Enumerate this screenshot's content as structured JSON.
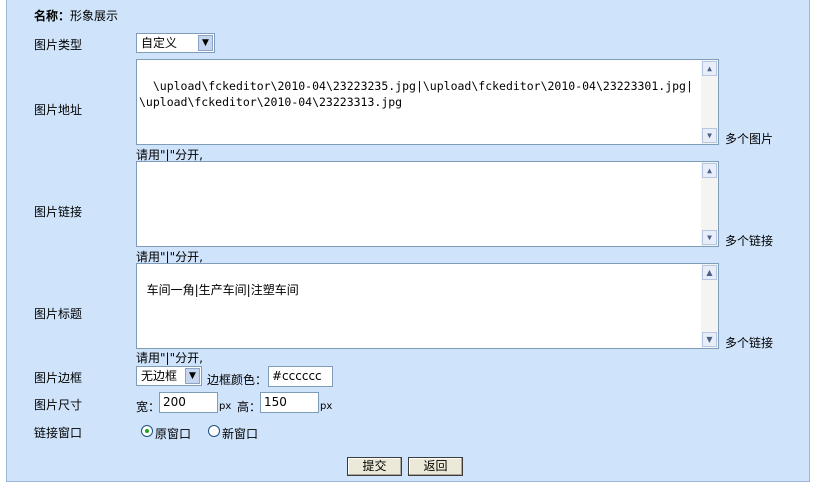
{
  "header": {
    "name_label": "名称：",
    "name_value": "形象展示"
  },
  "image_type": {
    "label": "图片类型",
    "value": "自定义"
  },
  "image_url": {
    "label": "图片地址",
    "value": "\\upload\\fckeditor\\2010-04\\23223235.jpg|\\upload\\fckeditor\\2010-04\\23223301.jpg|\\upload\\fckeditor\\2010-04\\23223313.jpg",
    "side_label": "多个图片",
    "hint": "请用\"|\"分开,"
  },
  "image_link": {
    "label": "图片链接",
    "value": "",
    "side_label": "多个链接",
    "hint": "请用\"|\"分开,"
  },
  "image_title": {
    "label": "图片标题",
    "value": "车间一角|生产车间|注塑车间",
    "side_label": "多个链接",
    "hint": "请用\"|\"分开,"
  },
  "image_border": {
    "label": "图片边框",
    "select_value": "无边框",
    "color_label": "边框颜色：",
    "color_value": "#cccccc"
  },
  "image_size": {
    "label": "图片尺寸",
    "width_label": "宽：",
    "width_value": "200",
    "unit": "px",
    "height_label": "高：",
    "height_value": "150"
  },
  "link_window": {
    "label": "链接窗口",
    "options": [
      {
        "label": "原窗口",
        "checked": true
      },
      {
        "label": "新窗口",
        "checked": false
      }
    ]
  },
  "buttons": {
    "submit": "提交",
    "back": "返回"
  },
  "icons": {
    "dropdown": "chevron-down-icon",
    "scroll_up": "arrow-up-icon",
    "scroll_down": "arrow-down-icon"
  }
}
